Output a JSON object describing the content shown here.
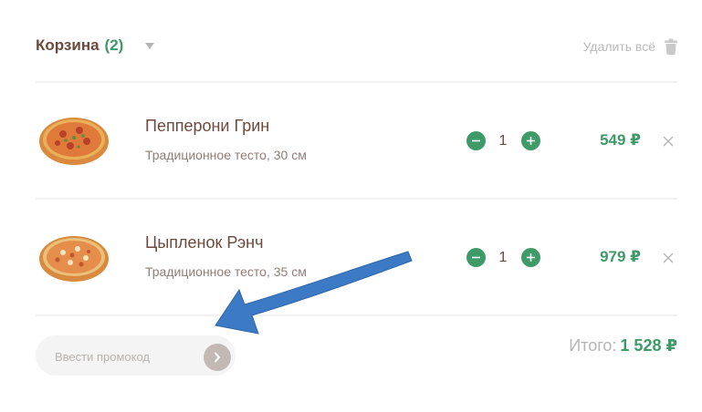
{
  "cart": {
    "title": "Корзина",
    "count": "(2)",
    "clear_label": "Удалить всё"
  },
  "items": [
    {
      "name": "Пепперони Грин",
      "description": "Традиционное тесто, 30 см",
      "quantity": "1",
      "price": "549 ₽"
    },
    {
      "name": "Цыпленок Рэнч",
      "description": "Традиционное тесто, 35 см",
      "quantity": "1",
      "price": "979 ₽"
    }
  ],
  "promo": {
    "placeholder": "Ввести промокод"
  },
  "total": {
    "label": "Итого:",
    "value": "1 528 ₽"
  },
  "colors": {
    "accent": "#3e9a67",
    "text": "#6b4a3e",
    "muted": "#b5b5b5",
    "annotation_arrow": "#3d7ac6"
  },
  "icons": {
    "caret": "caret-down-icon",
    "trash": "trash-icon",
    "minus": "minus-icon",
    "plus": "plus-icon",
    "remove": "close-icon",
    "submit": "chevron-right-icon"
  }
}
